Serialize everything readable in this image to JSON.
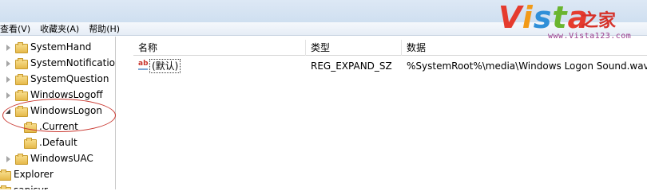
{
  "menubar": {
    "items": [
      "查看(V)",
      "收藏夹(A)",
      "帮助(H)"
    ]
  },
  "tree": {
    "items": [
      {
        "label": "SystemHand",
        "state": "collapsed"
      },
      {
        "label": "SystemNotificatio",
        "state": "collapsed"
      },
      {
        "label": "SystemQuestion",
        "state": "collapsed"
      },
      {
        "label": "WindowsLogoff",
        "state": "collapsed"
      },
      {
        "label": "WindowsLogon",
        "state": "expanded"
      },
      {
        "label": ".Current",
        "state": "leaf"
      },
      {
        "label": ".Default",
        "state": "leaf"
      },
      {
        "label": "WindowsUAC",
        "state": "collapsed"
      },
      {
        "label": "Explorer",
        "state": "leaf"
      },
      {
        "label": "sapisvr",
        "state": "leaf"
      }
    ]
  },
  "list": {
    "columns": [
      "名称",
      "类型",
      "数据"
    ],
    "rows": [
      {
        "name": "(默认)",
        "type": "REG_EXPAND_SZ",
        "data": "%SystemRoot%\\media\\Windows Logon Sound.wav"
      }
    ]
  },
  "logo": {
    "brand": "Vista",
    "suffix": "之家",
    "url": "www.Vista123.com"
  },
  "colors": {
    "annotation_ellipse": "#c9372f",
    "menubar_bg": "#e6edf6"
  }
}
